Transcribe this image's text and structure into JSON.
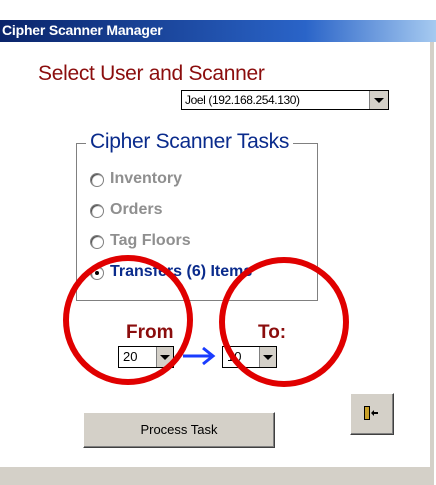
{
  "window": {
    "title": "Cipher Scanner Manager"
  },
  "header": {
    "select_label": "Select User and Scanner"
  },
  "scanner_select": {
    "value": "Joel (192.168.254.130)"
  },
  "tasks": {
    "title": "Cipher Scanner Tasks",
    "options": [
      {
        "label": "Inventory",
        "enabled": false,
        "selected": false
      },
      {
        "label": "Orders",
        "enabled": false,
        "selected": false
      },
      {
        "label": "Tag Floors",
        "enabled": false,
        "selected": false
      },
      {
        "label": "Transfers (6) Items",
        "enabled": true,
        "selected": true
      }
    ]
  },
  "transfer": {
    "from_label": "From",
    "to_label": "To:",
    "from_value": "20",
    "to_value": "10"
  },
  "actions": {
    "process_label": "Process Task",
    "exit_icon": "exit-door-icon"
  },
  "colors": {
    "title_bar": "#0a246a",
    "heading": "#8b0d0d",
    "group_title": "#0a2b8c",
    "annotation": "#e00000",
    "arrow": "#1a3cff"
  }
}
